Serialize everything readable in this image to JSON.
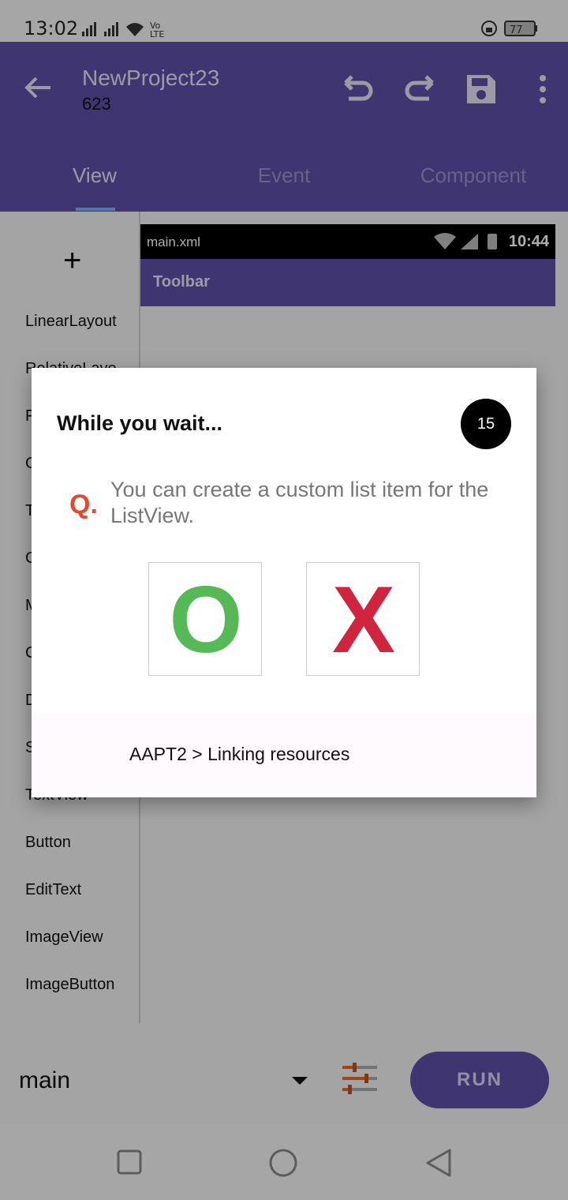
{
  "status_bar": {
    "time": "13:02",
    "battery": "77"
  },
  "app_bar": {
    "title": "NewProject23",
    "subtitle": "623",
    "tabs": [
      {
        "label": "View"
      },
      {
        "label": "Event"
      },
      {
        "label": "Component"
      }
    ]
  },
  "palette": {
    "items": [
      "LinearLayout",
      "RelativeLayo",
      "F",
      "G",
      "T",
      "C",
      "M",
      "C",
      "D",
      "S",
      "TextView",
      "Button",
      "EditText",
      "ImageView",
      "ImageButton"
    ]
  },
  "canvas": {
    "file_name": "main.xml",
    "clock": "10:44",
    "toolbar_title": "Toolbar"
  },
  "bottom_bar": {
    "file": "main",
    "run_label": "RUN"
  },
  "dialog": {
    "title": "While you wait...",
    "countdown": "15",
    "q_prefix": "Q.",
    "question": "You can create a custom list item for the ListView.",
    "answer_o": "O",
    "answer_x": "X",
    "progress_text": "AAPT2 > Linking resources"
  },
  "colors": {
    "primary": "#5e4fa6",
    "o_green": "#55b955",
    "x_red": "#d0253c",
    "q_orange": "#e2492f"
  }
}
